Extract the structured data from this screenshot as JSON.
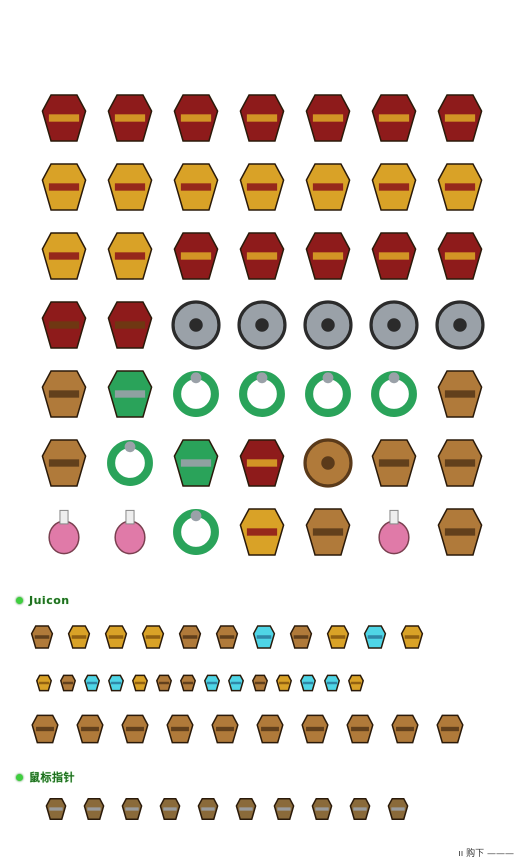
{
  "sections": [
    {
      "label": "Juicon"
    },
    {
      "label": "鼠标指针"
    }
  ],
  "footer": {
    "text": "ıı 购下 ———"
  },
  "palette": {
    "gold": "#d9a227",
    "darkRed": "#8e1b1b",
    "purple": "#5a2f9e",
    "steel": "#9aa1a8",
    "green": "#2aa35a",
    "cyan": "#4fd5e6",
    "pink": "#e07aa8"
  },
  "equipment_rows": [
    [
      "robe-icon",
      "robe-icon",
      "armor-icon",
      "robe-icon",
      "armor-icon",
      "armor-icon",
      "armor-icon"
    ],
    [
      "gauntlet-icon",
      "gauntlet-icon",
      "gauntlet-icon",
      "bracer-icon",
      "bracer-icon",
      "bracer-icon",
      "bracer-icon"
    ],
    [
      "gauntlet-icon",
      "gauntlet-icon",
      "helmet-icon",
      "helmet-icon",
      "armor-icon",
      "belt-icon",
      "belt-icon"
    ],
    [
      "pants-icon",
      "pants-icon",
      "shield-icon",
      "shield-icon",
      "shield-icon",
      "shield-icon",
      "shield-icon"
    ],
    [
      "boots-icon",
      "amulet-icon",
      "necklace-icon",
      "necklace-icon",
      "ring-icon",
      "ring-icon",
      "spear-icon"
    ],
    [
      "axe-icon",
      "ring-icon",
      "amulet-icon",
      "armor-icon",
      "orb-icon",
      "scroll-icon",
      "scroll-icon"
    ],
    [
      "potion-icon",
      "potion-icon",
      "ring-icon",
      "bracer-icon",
      "food-icon",
      "potion-icon",
      "chest-icon"
    ]
  ],
  "ui_rows": [
    [
      "bar-icon",
      "star-icon",
      "gold-icon",
      "star-icon",
      "face-icon",
      "thumbs-up-icon",
      "gem-icon",
      "heart-icon",
      "crown-icon",
      "diamond-icon",
      "star-icon"
    ],
    [
      "gold-icon",
      "arrow-icon",
      "gem-icon",
      "gem-icon",
      "gold-icon",
      "fire-icon",
      "gear-icon",
      "crystal-icon",
      "crystal-icon",
      "heart-icon",
      "gold-icon",
      "gem-icon",
      "gem-icon",
      "gold-icon"
    ],
    [
      "castle-icon",
      "map-icon",
      "wall-icon",
      "flower-icon",
      "scroll-icon",
      "bowl-icon",
      "chest-icon",
      "bag-icon",
      "cabinet-icon",
      "broom-icon"
    ]
  ],
  "cursor_row": [
    "sword-cursor-icon",
    "hammer-cursor-icon",
    "wand-cursor-icon",
    "key-cursor-icon",
    "gear-cursor-icon",
    "brush-cursor-icon",
    "pickaxe-cursor-icon",
    "plant-cursor-icon",
    "tray-cursor-icon",
    "wrench-cursor-icon"
  ]
}
